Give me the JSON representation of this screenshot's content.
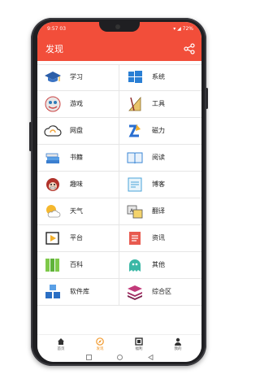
{
  "status": {
    "time": "9:57 03",
    "battery": "72%"
  },
  "appbar": {
    "title": "发现"
  },
  "grid": [
    {
      "left": {
        "label": "学习",
        "icon": "graduation-cap-icon"
      },
      "right": {
        "label": "系统",
        "icon": "windows-logo-icon"
      }
    },
    {
      "left": {
        "label": "游戏",
        "icon": "game-mascot-icon"
      },
      "right": {
        "label": "工具",
        "icon": "ruler-compass-icon"
      }
    },
    {
      "left": {
        "label": "网盘",
        "icon": "cloud-drive-icon"
      },
      "right": {
        "label": "磁力",
        "icon": "magnet-icon"
      }
    },
    {
      "left": {
        "label": "书籍",
        "icon": "books-icon"
      },
      "right": {
        "label": "阅读",
        "icon": "open-book-icon"
      }
    },
    {
      "left": {
        "label": "趣味",
        "icon": "monkey-face-icon"
      },
      "right": {
        "label": "博客",
        "icon": "blog-icon"
      }
    },
    {
      "left": {
        "label": "天气",
        "icon": "weather-sun-cloud-icon"
      },
      "right": {
        "label": "翻译",
        "icon": "translate-icon"
      }
    },
    {
      "left": {
        "label": "平台",
        "icon": "play-platform-icon"
      },
      "right": {
        "label": "资讯",
        "icon": "news-icon"
      }
    },
    {
      "left": {
        "label": "百科",
        "icon": "encyclopedia-books-icon"
      },
      "right": {
        "label": "其他",
        "icon": "ghost-icon"
      }
    },
    {
      "left": {
        "label": "软件库",
        "icon": "software-boxes-icon"
      },
      "right": {
        "label": "综合区",
        "icon": "stacked-layers-icon"
      }
    }
  ],
  "bottom_nav": [
    {
      "label": "首页",
      "icon": "home-icon",
      "active": false
    },
    {
      "label": "发现",
      "icon": "discover-compass-icon",
      "active": true
    },
    {
      "label": "福利",
      "icon": "gift-box-icon",
      "active": false
    },
    {
      "label": "我的",
      "icon": "profile-icon",
      "active": false
    }
  ],
  "colors": {
    "accent": "#f24e3a",
    "active_nav": "#f29a2e"
  }
}
